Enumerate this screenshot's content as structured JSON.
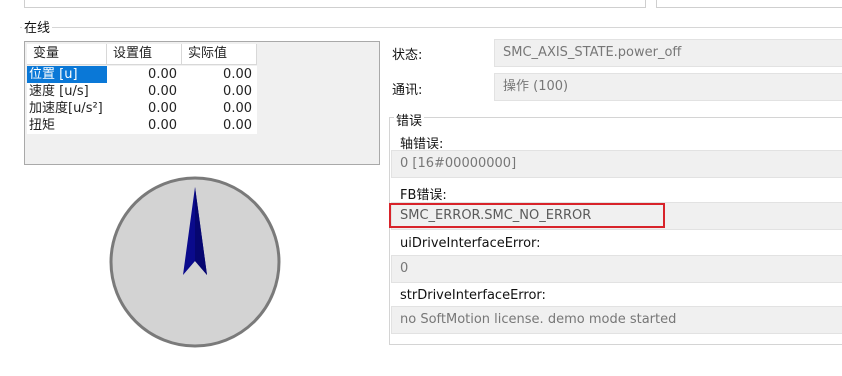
{
  "group": {
    "title": "在线"
  },
  "table": {
    "headers": [
      "变量",
      "设置值",
      "实际值"
    ],
    "rows": [
      {
        "name": "位置 [u]",
        "set": "0.00",
        "actual": "0.00",
        "selected": true
      },
      {
        "name": "速度 [u/s]",
        "set": "0.00",
        "actual": "0.00",
        "selected": false
      },
      {
        "name": "加速度[u/s²]",
        "set": "0.00",
        "actual": "0.00",
        "selected": false
      },
      {
        "name": "扭矩",
        "set": "0.00",
        "actual": "0.00",
        "selected": false
      }
    ]
  },
  "status": {
    "state_label": "状态:",
    "state_value": "SMC_AXIS_STATE.power_off",
    "comm_label": "通讯:",
    "comm_value": "操作 (100)"
  },
  "errors": {
    "title": "错误",
    "axis_error_label": "轴错误:",
    "axis_error_value": "0 [16#00000000]",
    "fb_error_label": "FB错误:",
    "fb_error_value": "SMC_ERROR.SMC_NO_ERROR",
    "ui_drive_label": "uiDriveInterfaceError:",
    "ui_drive_value": "0",
    "str_drive_label": "strDriveInterfaceError:",
    "str_drive_value": "no SoftMotion license. demo mode started"
  },
  "colors": {
    "selection": "#0a78d7",
    "highlight_border": "#d8232a",
    "needle": "#0a0a8c",
    "dial_fill": "#d3d3d3"
  },
  "dial": {
    "needle_angle_deg": 0
  }
}
